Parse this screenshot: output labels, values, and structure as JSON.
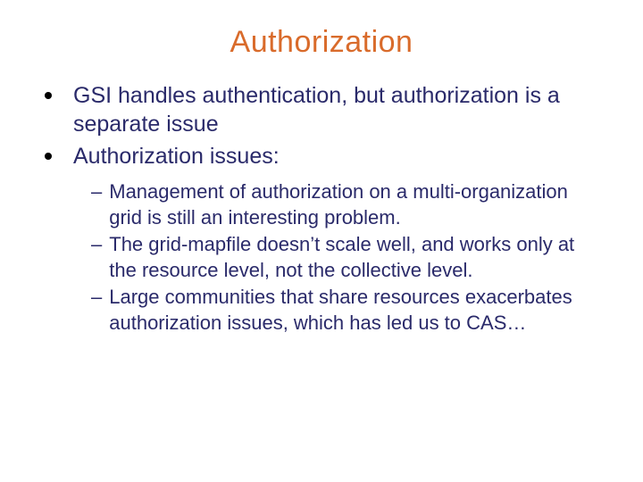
{
  "title": "Authorization",
  "bullets": [
    "GSI handles authentication, but authorization is a separate issue",
    "Authorization issues:"
  ],
  "subbullets": [
    "Management of authorization on a multi-organization grid is still an interesting problem.",
    "The grid-mapfile doesn’t scale well, and works only at the resource level, not the collective level.",
    "Large communities that share resources exacerbates authorization issues, which has led us to CAS…"
  ]
}
